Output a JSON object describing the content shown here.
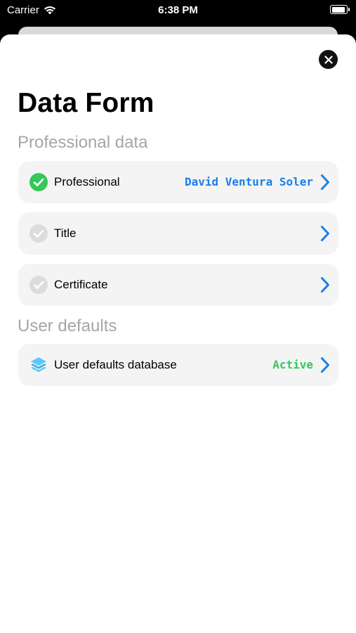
{
  "status_bar": {
    "carrier": "Carrier",
    "time": "6:38 PM",
    "battery_level": 0.95
  },
  "title": "Data Form",
  "sections": [
    {
      "title": "Professional data",
      "rows": [
        {
          "label": "Professional",
          "value": "David Ventura Soler",
          "icon": "checkmark-filled-icon",
          "value_color": "#1a7fe8"
        },
        {
          "label": "Title",
          "value": "",
          "icon": "checkmark-empty-icon"
        },
        {
          "label": "Certificate",
          "value": "",
          "icon": "checkmark-empty-icon"
        }
      ]
    },
    {
      "title": "User defaults",
      "rows": [
        {
          "label": "User defaults database",
          "value": "Active",
          "icon": "layers-icon",
          "value_color": "#34c759"
        }
      ]
    }
  ],
  "colors": {
    "accent": "#1a7fe8",
    "success": "#34c759",
    "row_bg": "#f4f4f4",
    "section_text": "#a6a6a6"
  }
}
